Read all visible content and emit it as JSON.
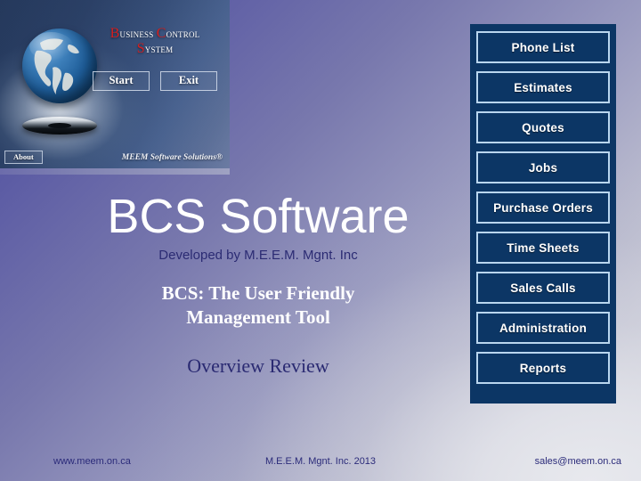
{
  "slide": {
    "background_top_color": "#4f4f9d",
    "background_bottom_color": "#dfe0e4"
  },
  "splash": {
    "product_name_line1_cap": "B",
    "product_name_line1_rest": "usiness",
    "product_name_line1_cap2": "C",
    "product_name_line1_rest2": "ontrol",
    "product_name_line2_cap": "S",
    "product_name_line2_rest": "ystem",
    "start_button": "Start",
    "exit_button": "Exit",
    "about_button": "About",
    "vendor_mark": "MEEM Software Solutions®",
    "globe_icon": "globe-icon"
  },
  "main": {
    "title": "BCS Software",
    "subtitle": "Developed by M.E.E.M. Mgnt. Inc",
    "tagline_line1": "BCS: The User  Friendly",
    "tagline_line2": "Management Tool",
    "section": "Overview Review"
  },
  "menu": {
    "panel_color": "#0c3665",
    "border_color": "#b9d6ef",
    "items": [
      {
        "label": "Phone List"
      },
      {
        "label": "Estimates"
      },
      {
        "label": "Quotes"
      },
      {
        "label": "Jobs"
      },
      {
        "label": "Purchase Orders"
      },
      {
        "label": "Time Sheets"
      },
      {
        "label": "Sales Calls"
      },
      {
        "label": "Administration"
      },
      {
        "label": "Reports"
      }
    ]
  },
  "footer": {
    "website": "www.meem.on.ca",
    "copyright": "M.E.E.M. Mgnt. Inc. 2013",
    "email": "sales@meem.on.ca"
  }
}
